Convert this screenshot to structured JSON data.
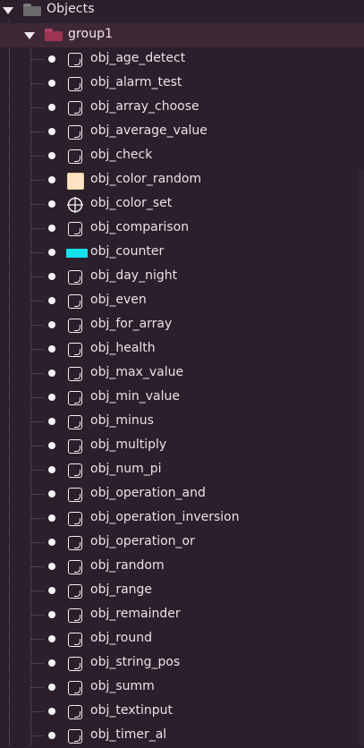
{
  "root": {
    "label": "Objects",
    "icon": "folder-icon"
  },
  "group": {
    "label": "group1",
    "icon": "folder-icon",
    "color": "#a13a58"
  },
  "colors": {
    "background": "#2b1f2b",
    "group_highlight": "#3f2836",
    "root_folder": "#7a7a7a",
    "group_folder": "#a13a58",
    "swatch_color_random": "#ffe3c2",
    "bar_counter": "#14e0ee"
  },
  "items": [
    {
      "label": "obj_age_detect",
      "icon": "object-icon"
    },
    {
      "label": "obj_alarm_test",
      "icon": "object-icon"
    },
    {
      "label": "obj_array_choose",
      "icon": "object-icon"
    },
    {
      "label": "obj_average_value",
      "icon": "object-icon"
    },
    {
      "label": "obj_check",
      "icon": "object-icon"
    },
    {
      "label": "obj_color_random",
      "icon": "sprite-swatch-icon"
    },
    {
      "label": "obj_color_set",
      "icon": "crosshair-icon"
    },
    {
      "label": "obj_comparison",
      "icon": "object-icon"
    },
    {
      "label": "obj_counter",
      "icon": "sprite-bar-icon"
    },
    {
      "label": "obj_day_night",
      "icon": "object-icon"
    },
    {
      "label": "obj_even",
      "icon": "object-icon"
    },
    {
      "label": "obj_for_array",
      "icon": "object-icon"
    },
    {
      "label": "obj_health",
      "icon": "object-icon"
    },
    {
      "label": "obj_max_value",
      "icon": "object-icon"
    },
    {
      "label": "obj_min_value",
      "icon": "object-icon"
    },
    {
      "label": "obj_minus",
      "icon": "object-icon"
    },
    {
      "label": "obj_multiply",
      "icon": "object-icon"
    },
    {
      "label": "obj_num_pi",
      "icon": "object-icon"
    },
    {
      "label": "obj_operation_and",
      "icon": "object-icon"
    },
    {
      "label": "obj_operation_inversion",
      "icon": "object-icon"
    },
    {
      "label": "obj_operation_or",
      "icon": "object-icon"
    },
    {
      "label": "obj_random",
      "icon": "object-icon"
    },
    {
      "label": "obj_range",
      "icon": "object-icon"
    },
    {
      "label": "obj_remainder",
      "icon": "object-icon"
    },
    {
      "label": "obj_round",
      "icon": "object-icon"
    },
    {
      "label": "obj_string_pos",
      "icon": "object-icon"
    },
    {
      "label": "obj_summ",
      "icon": "object-icon"
    },
    {
      "label": "obj_textinput",
      "icon": "object-icon"
    },
    {
      "label": "obj_timer_al",
      "icon": "object-icon"
    }
  ]
}
